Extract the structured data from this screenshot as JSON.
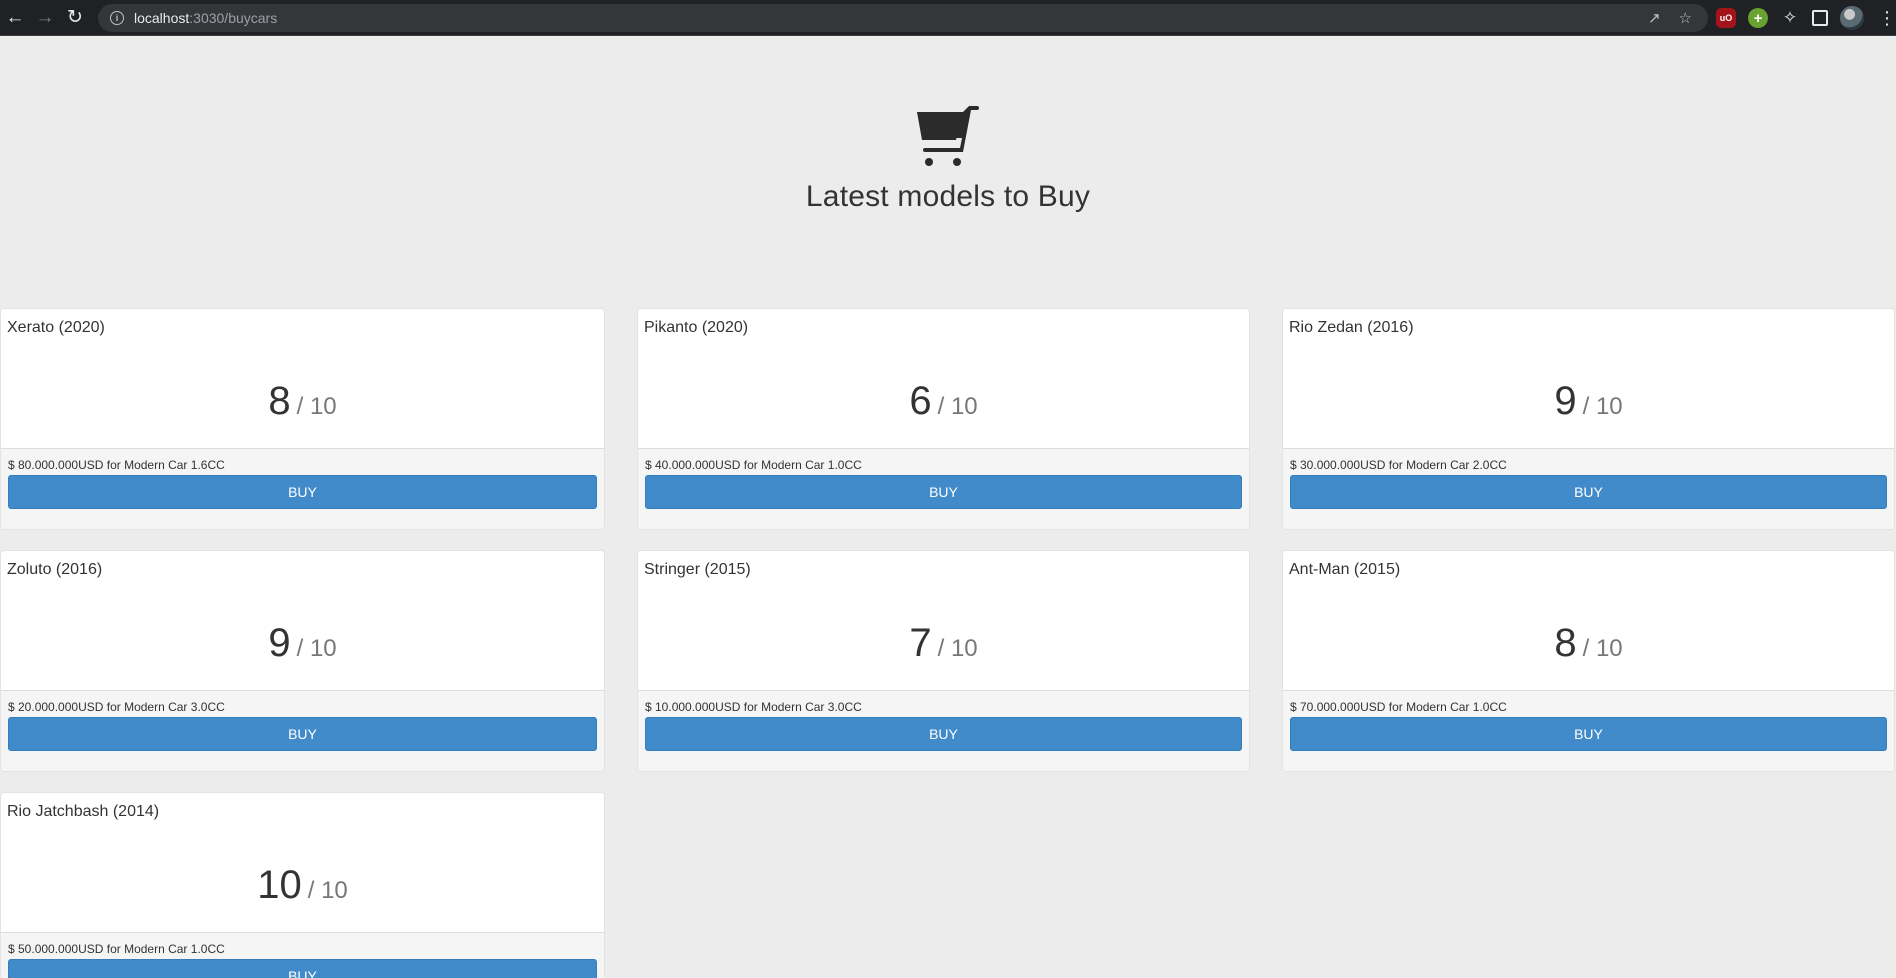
{
  "browser": {
    "url_host": "localhost",
    "url_rest": ":3030/buycars"
  },
  "hero": {
    "icon": "shopping-cart-icon",
    "title": "Latest models to Buy"
  },
  "cars": [
    {
      "name": "Xerato (2020)",
      "score": "8",
      "max": "/ 10",
      "price": "$ 80.000.000USD for Modern Car 1.6CC",
      "buy": "BUY"
    },
    {
      "name": "Pikanto (2020)",
      "score": "6",
      "max": "/ 10",
      "price": "$ 40.000.000USD for Modern Car 1.0CC",
      "buy": "BUY"
    },
    {
      "name": "Rio Zedan (2016)",
      "score": "9",
      "max": "/ 10",
      "price": "$ 30.000.000USD for Modern Car 2.0CC",
      "buy": "BUY"
    },
    {
      "name": "Zoluto (2016)",
      "score": "9",
      "max": "/ 10",
      "price": "$ 20.000.000USD for Modern Car 3.0CC",
      "buy": "BUY"
    },
    {
      "name": "Stringer (2015)",
      "score": "7",
      "max": "/ 10",
      "price": "$ 10.000.000USD for Modern Car 3.0CC",
      "buy": "BUY"
    },
    {
      "name": "Ant-Man (2015)",
      "score": "8",
      "max": "/ 10",
      "price": "$ 70.000.000USD for Modern Car 1.0CC",
      "buy": "BUY"
    },
    {
      "name": "Rio Jatchbash (2014)",
      "score": "10",
      "max": "/ 10",
      "price": "$ 50.000.000USD for Modern Car 1.0CC",
      "buy": "BUY"
    }
  ],
  "colors": {
    "button": "#428bca",
    "page_bg": "#ececec",
    "chrome_bg": "#202124"
  }
}
